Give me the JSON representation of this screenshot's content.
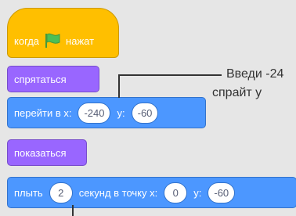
{
  "blocks": {
    "when_flag": {
      "prefix": "когда",
      "suffix": "нажат",
      "flag_color": "#4cbf56"
    },
    "hide": {
      "label": "спрятаться"
    },
    "goto": {
      "label": "перейти в x:",
      "x_value": "-240",
      "y_label": "y:",
      "y_value": "-60"
    },
    "show": {
      "label": "показаться"
    },
    "glide": {
      "label": "плыть",
      "seconds": "2",
      "mid_label": "секунд в точку x:",
      "x_value": "0",
      "y_label": "y:",
      "y_value": "-60"
    }
  },
  "annotation": {
    "line1": "Введи -24",
    "line2": "спрайт у"
  },
  "colors": {
    "events": "#ffbf00",
    "looks": "#9966ff",
    "motion": "#4c97ff",
    "background": "#e6e6e6"
  }
}
